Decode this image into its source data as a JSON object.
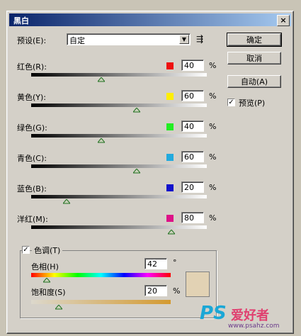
{
  "window": {
    "title": "黑白",
    "close": "×"
  },
  "preset": {
    "label": "预设(E):",
    "value": "自定"
  },
  "buttons": {
    "ok": "确定",
    "cancel": "取消",
    "auto": "自动(A)"
  },
  "preview": {
    "label": "预览(P)",
    "checked": true,
    "check": "✓"
  },
  "sliders": [
    {
      "label": "红色(R):",
      "value": "40",
      "unit": "%",
      "color": "#ee1010",
      "position": 0.4
    },
    {
      "label": "黄色(Y):",
      "value": "60",
      "unit": "%",
      "color": "#ffee00",
      "position": 0.6
    },
    {
      "label": "绿色(G):",
      "value": "40",
      "unit": "%",
      "color": "#22ee22",
      "position": 0.4
    },
    {
      "label": "青色(C):",
      "value": "60",
      "unit": "%",
      "color": "#22aadd",
      "position": 0.6
    },
    {
      "label": "蓝色(B):",
      "value": "20",
      "unit": "%",
      "color": "#1111cc",
      "position": 0.2
    },
    {
      "label": "洋红(M):",
      "value": "80",
      "unit": "%",
      "color": "#dd1188",
      "position": 0.8
    }
  ],
  "tint": {
    "label": "色调(T)",
    "checked": true,
    "check": "✓",
    "hue": {
      "label": "色相(H)",
      "value": "42",
      "unit": "°",
      "position": 0.11
    },
    "saturation": {
      "label": "饱和度(S)",
      "value": "20",
      "unit": "%",
      "position": 0.2
    },
    "swatch_color": "#e2d2b4"
  },
  "watermark": {
    "logo": "PS",
    "tagline": "爱好者",
    "url": "www.psahz.com"
  }
}
